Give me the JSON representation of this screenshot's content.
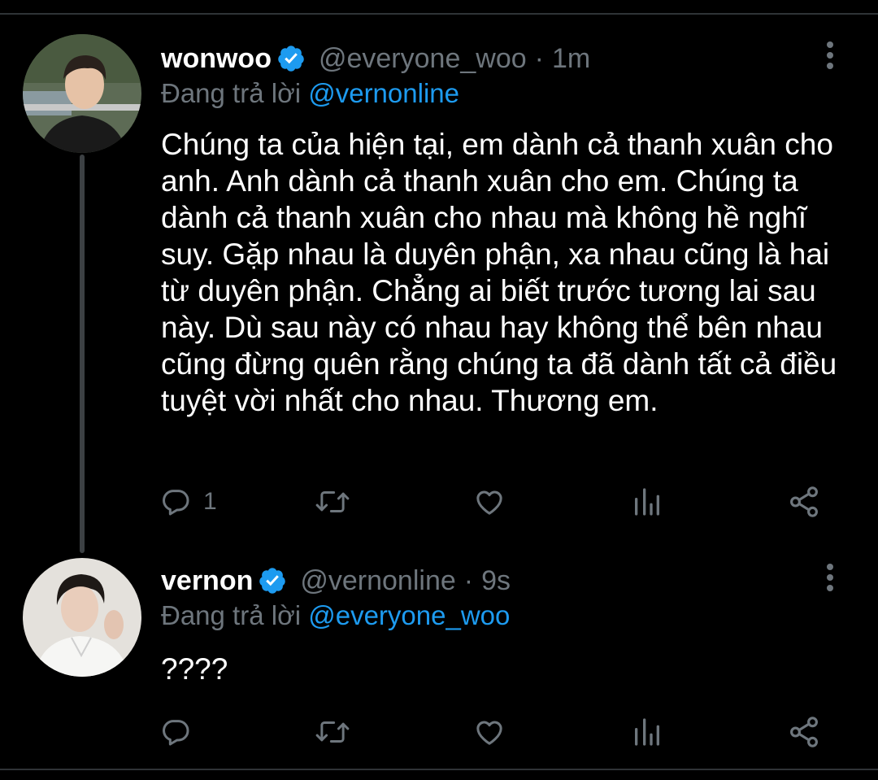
{
  "colors": {
    "background": "#000000",
    "text": "#ffffff",
    "muted": "#6e767d",
    "accent": "#1d9bf0",
    "divider": "#2f3336"
  },
  "tweets": [
    {
      "display_name": "wonwoo",
      "verified_icon": "verified-badge-icon",
      "handle": "@everyone_woo",
      "separator": "·",
      "time": "1m",
      "reply_prefix": "Đang trả lời",
      "reply_to": "@vernonline",
      "text": "Chúng ta của hiện tại, em dành cả thanh xuân cho anh. Anh dành cả thanh xuân cho em. Chúng ta dành cả thanh xuân cho nhau mà không hề nghĩ suy. Gặp nhau là duyên phận, xa nhau cũng là hai từ duyên phận. Chẳng ai biết trước tương lai sau này. Dù sau này có nhau hay không thể bên nhau cũng đừng quên rằng chúng ta đã dành tất cả điều tuyệt vời nhất cho nhau. Thương em.",
      "reply_count": "1"
    },
    {
      "display_name": "vernon",
      "verified_icon": "verified-badge-icon",
      "handle": "@vernonline",
      "separator": "·",
      "time": "9s",
      "reply_prefix": "Đang trả lời",
      "reply_to": "@everyone_woo",
      "text": "????",
      "reply_count": ""
    }
  ]
}
